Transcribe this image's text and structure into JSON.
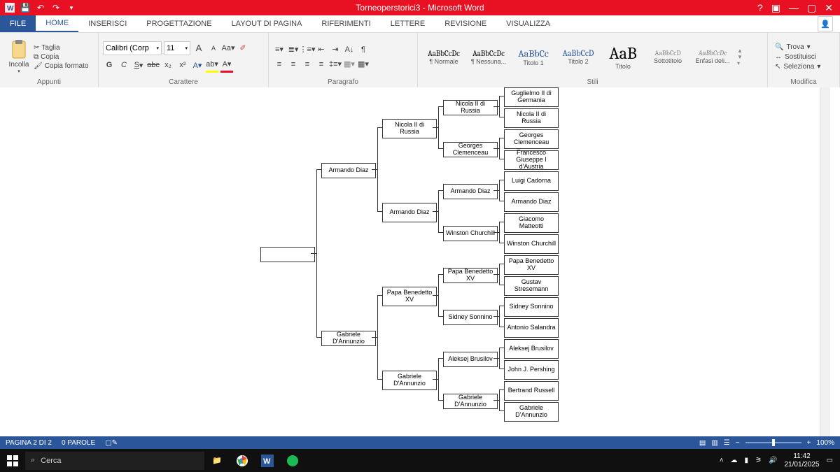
{
  "titlebar": {
    "doc_title": "Torneoperstorici3 - Microsoft Word"
  },
  "tabs": {
    "file": "FILE",
    "home": "HOME",
    "insert": "INSERISCI",
    "design": "PROGETTAZIONE",
    "layout": "LAYOUT DI PAGINA",
    "references": "RIFERIMENTI",
    "mailings": "LETTERE",
    "review": "REVISIONE",
    "view": "VISUALIZZA"
  },
  "clipboard": {
    "paste": "Incolla",
    "cut": "Taglia",
    "copy": "Copia",
    "painter": "Copia formato",
    "group": "Appunti"
  },
  "font": {
    "family": "Calibri (Corp",
    "size": "11",
    "group": "Carattere"
  },
  "paragraph": {
    "group": "Paragrafo"
  },
  "styles": {
    "group": "Stili",
    "items": [
      {
        "prev": "AaBbCcDc",
        "lbl": "¶ Normale",
        "size": "11px",
        "color": "#000"
      },
      {
        "prev": "AaBbCcDc",
        "lbl": "¶ Nessuna...",
        "size": "11px",
        "color": "#000"
      },
      {
        "prev": "AaBbCc",
        "lbl": "Titolo 1",
        "size": "14px",
        "color": "#2b579a"
      },
      {
        "prev": "AaBbCcD",
        "lbl": "Titolo 2",
        "size": "12px",
        "color": "#2b579a"
      },
      {
        "prev": "AaB",
        "lbl": "Titolo",
        "size": "24px",
        "color": "#000"
      },
      {
        "prev": "AaBbCcD",
        "lbl": "Sottotitolo",
        "size": "10px",
        "color": "#888"
      },
      {
        "prev": "AaBbCcDc",
        "lbl": "Enfasi deli...",
        "size": "10px",
        "color": "#888",
        "italic": true
      }
    ]
  },
  "editing": {
    "find": "Trova",
    "replace": "Sostituisci",
    "select": "Seleziona",
    "group": "Modifica"
  },
  "status": {
    "page": "PAGINA 2 DI 2",
    "words": "0 PAROLE",
    "zoom": "100%"
  },
  "taskbar": {
    "search_placeholder": "Cerca",
    "time": "11:42",
    "date": "21/01/2025"
  },
  "bracket": {
    "col1": [
      ""
    ],
    "col2": [
      "Armando Diaz",
      "Gabriele D'Annunzio"
    ],
    "col3": [
      "Nicola II di Russia",
      "Armando Diaz",
      "Papa Benedetto XV",
      "Gabriele D'Annunzio"
    ],
    "col4": [
      "Nicola II di Russia",
      "Georges Clemenceau",
      "Armando Diaz",
      "Winston Churchill",
      "Papa Benedetto XV",
      "Sidney Sonnino",
      "Aleksej Brusilov",
      "Gabriele D'Annunzio"
    ],
    "col5": [
      "Guglielmo II di Germania",
      "Nicola II di Russia",
      "Georges Clemenceau",
      "Francesco Giuseppe I d'Austria",
      "Luigi Cadorna",
      "Armando Diaz",
      "Giacomo Matteotti",
      "Winston Churchill",
      "Papa Benedetto XV",
      "Gustav Stresemann",
      "Sidney Sonnino",
      "Antonio Salandra",
      "Aleksej Brusilov",
      "John J. Pershing",
      "Bertrand Russell",
      "Gabriele D'Annunzio"
    ]
  }
}
